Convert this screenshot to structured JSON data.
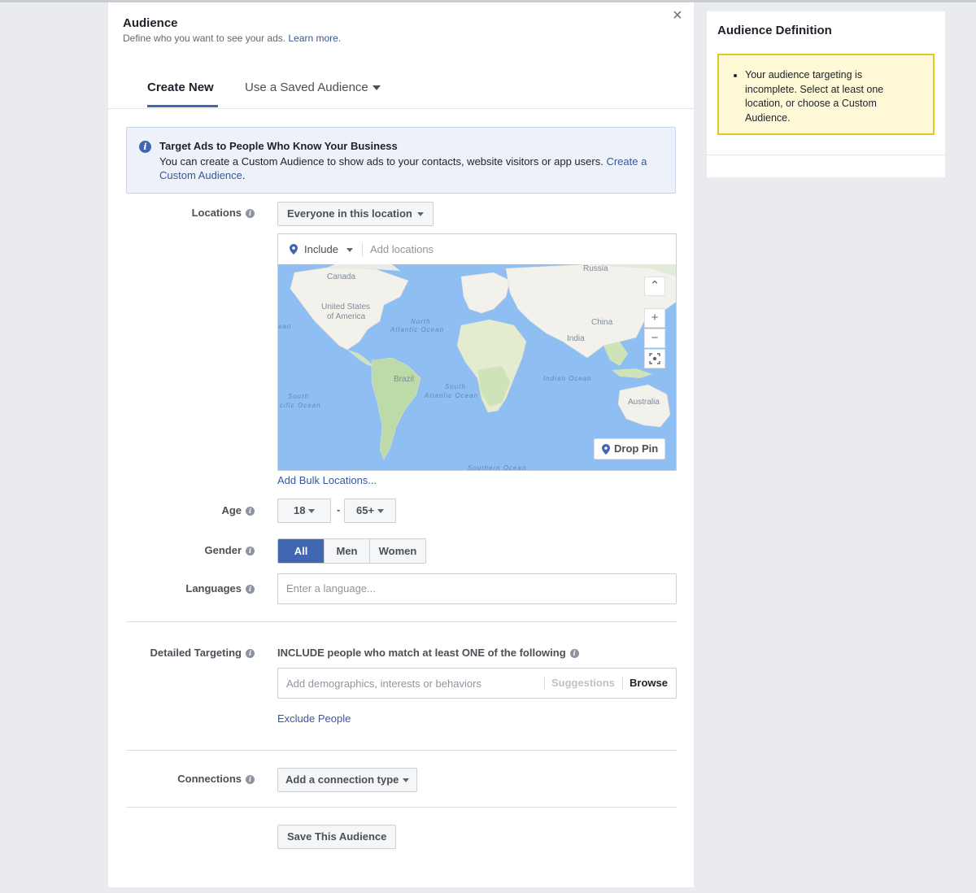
{
  "header": {
    "title": "Audience",
    "subtitle": "Define who you want to see your ads.",
    "learn_more": "Learn more.",
    "close_glyph": "×"
  },
  "tabs": [
    {
      "label": "Create New",
      "active": true
    },
    {
      "label": "Use a Saved Audience",
      "active": false
    }
  ],
  "info": {
    "title": "Target Ads to People Who Know Your Business",
    "body": "You can create a Custom Audience to show ads to your contacts, website visitors or app users.",
    "link": "Create a Custom Audience",
    "period": "."
  },
  "locations": {
    "label": "Locations",
    "mode": "Everyone in this location",
    "include": "Include",
    "placeholder": "Add locations",
    "bulk_link": "Add Bulk Locations...",
    "drop_pin": "Drop Pin",
    "map_labels": {
      "canada": "Canada",
      "russia": "Russia",
      "usa1": "United States",
      "usa2": "of America",
      "china": "China",
      "india": "India",
      "brazil": "Brazil",
      "australia": "Australia",
      "pacific_partial": "ean",
      "north_atlantic1": "North",
      "north_atlantic2": "Atlantic Ocean",
      "south_atlantic1": "South",
      "south_atlantic2": "Atlantic Ocean",
      "south_pacific1": "South",
      "south_pacific2": "cific Ocean",
      "indian": "Indian Ocean",
      "southern": "Southern Ocean"
    }
  },
  "age": {
    "label": "Age",
    "min": "18",
    "dash": "-",
    "max": "65+"
  },
  "gender": {
    "label": "Gender",
    "options": [
      "All",
      "Men",
      "Women"
    ],
    "selected": "All"
  },
  "languages": {
    "label": "Languages",
    "placeholder": "Enter a language..."
  },
  "detailed": {
    "label": "Detailed Targeting",
    "heading": "INCLUDE people who match at least ONE of the following",
    "placeholder": "Add demographics, interests or behaviors",
    "suggestions": "Suggestions",
    "browse": "Browse",
    "exclude_link": "Exclude People"
  },
  "connections": {
    "label": "Connections",
    "button": "Add a connection type"
  },
  "save_button": "Save This Audience",
  "sidebar": {
    "title": "Audience Definition",
    "warning": "Your audience targeting is incomplete. Select at least one location, or choose a Custom Audience."
  },
  "colors": {
    "accent": "#4267b2",
    "link": "#365899",
    "warning_bg": "#fff9d7",
    "warning_border": "#e2c822"
  }
}
